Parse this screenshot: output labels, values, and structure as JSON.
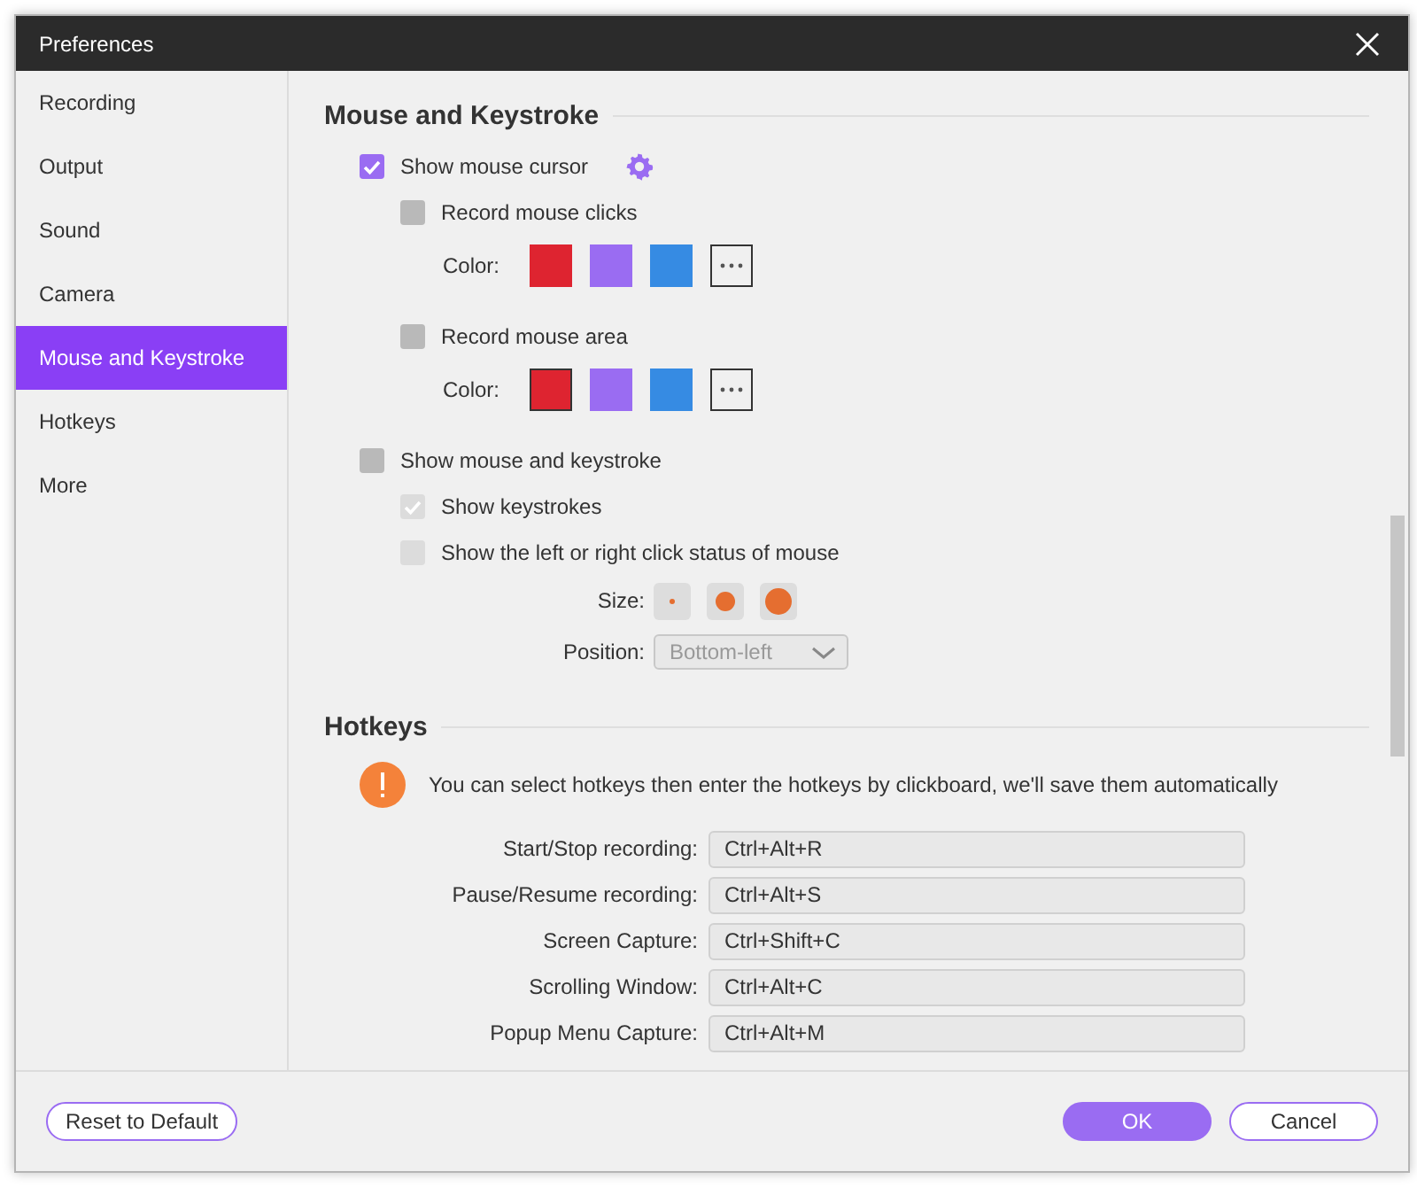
{
  "window": {
    "title": "Preferences"
  },
  "sidebar": {
    "items": [
      {
        "label": "Recording",
        "selected": false
      },
      {
        "label": "Output",
        "selected": false
      },
      {
        "label": "Sound",
        "selected": false
      },
      {
        "label": "Camera",
        "selected": false
      },
      {
        "label": "Mouse and Keystroke",
        "selected": true
      },
      {
        "label": "Hotkeys",
        "selected": false
      },
      {
        "label": "More",
        "selected": false
      }
    ]
  },
  "mouse_section": {
    "title": "Mouse and Keystroke",
    "options": [
      {
        "kind": "checkbox",
        "label": "Show mouse cursor",
        "checked": true,
        "disabled": false,
        "has_settings": true,
        "children": [
          {
            "kind": "checkbox",
            "label": "Record mouse clicks",
            "checked": false,
            "disabled": false
          },
          {
            "kind": "colors",
            "label": "Color:",
            "swatches": [
              {
                "color": "#de2430",
                "selected": false
              },
              {
                "color": "#9a6cf2",
                "selected": false
              },
              {
                "color": "#368be3",
                "selected": false
              }
            ]
          },
          {
            "kind": "checkbox",
            "label": "Record mouse area",
            "checked": false,
            "disabled": false
          },
          {
            "kind": "colors",
            "label": "Color:",
            "swatches": [
              {
                "color": "#de2430",
                "selected": true
              },
              {
                "color": "#9a6cf2",
                "selected": false
              },
              {
                "color": "#368be3",
                "selected": false
              }
            ]
          }
        ]
      },
      {
        "kind": "checkbox",
        "label": "Show mouse and keystroke",
        "checked": false,
        "disabled": false,
        "has_settings": false,
        "children": [
          {
            "kind": "checkbox",
            "label": "Show keystrokes",
            "checked": true,
            "disabled": true
          },
          {
            "kind": "checkbox",
            "label": "Show the left or right click status of mouse",
            "checked": false,
            "disabled": true
          },
          {
            "kind": "sizes",
            "label": "Size:",
            "disabled": true,
            "options": [
              {
                "kind": "small"
              },
              {
                "kind": "medium"
              },
              {
                "kind": "large"
              }
            ]
          },
          {
            "kind": "dropdown",
            "label": "Position:",
            "value": "Bottom-left",
            "disabled": true
          }
        ]
      }
    ]
  },
  "hotkeys_section": {
    "title": "Hotkeys",
    "notice": "You can select hotkeys then enter the hotkeys by clickboard, we'll save them automatically",
    "rows": [
      {
        "label": "Start/Stop recording:",
        "value": "Ctrl+Alt+R"
      },
      {
        "label": "Pause/Resume recording:",
        "value": "Ctrl+Alt+S"
      },
      {
        "label": "Screen Capture:",
        "value": "Ctrl+Shift+C"
      },
      {
        "label": "Scrolling Window:",
        "value": "Ctrl+Alt+C"
      },
      {
        "label": "Popup Menu Capture:",
        "value": "Ctrl+Alt+M"
      }
    ]
  },
  "footer": {
    "buttons": [
      {
        "label": "Reset to Default",
        "kind": "reset"
      },
      {
        "label": "OK",
        "kind": "primary"
      },
      {
        "label": "Cancel",
        "kind": "secondary"
      }
    ]
  }
}
